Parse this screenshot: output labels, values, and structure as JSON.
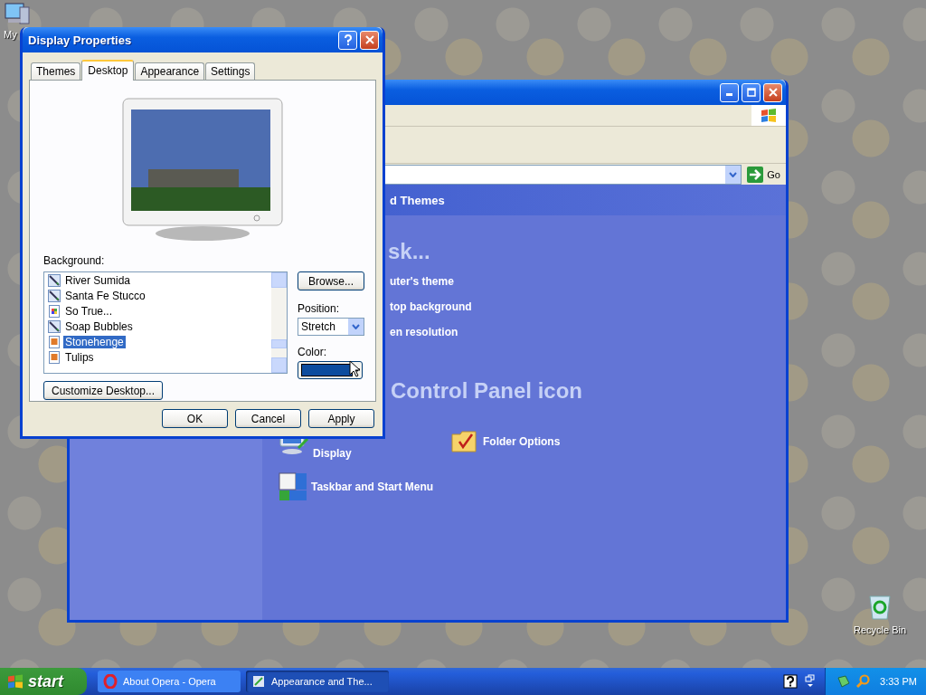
{
  "desktop_icons": [
    {
      "label": "My",
      "kind": "computer"
    },
    {
      "label": "Recycle Bin",
      "kind": "recycle"
    }
  ],
  "explorer_window": {
    "go_button": "Go",
    "header": "d Themes",
    "task_heading": "sk...",
    "tasks": [
      "uter's theme",
      "top background",
      "en resolution"
    ],
    "icon_heading": "Control Panel icon",
    "icons": [
      {
        "label": "Display",
        "kind": "display"
      },
      {
        "label": "Folder Options",
        "kind": "folder"
      },
      {
        "label": "Taskbar and Start Menu",
        "kind": "taskbar"
      }
    ]
  },
  "dialog": {
    "title": "Display Properties",
    "tabs": [
      {
        "label": "Themes",
        "selected": false
      },
      {
        "label": "Desktop",
        "selected": true
      },
      {
        "label": "Appearance",
        "selected": false
      },
      {
        "label": "Settings",
        "selected": false
      }
    ],
    "background_label": "Background:",
    "backgrounds": [
      {
        "label": "River Sumida",
        "kind": "brush",
        "selected": false
      },
      {
        "label": "Santa Fe Stucco",
        "kind": "brush",
        "selected": false
      },
      {
        "label": "So True...",
        "kind": "picture",
        "selected": false
      },
      {
        "label": "Soap Bubbles",
        "kind": "brush",
        "selected": false
      },
      {
        "label": "Stonehenge",
        "kind": "image",
        "selected": true
      },
      {
        "label": "Tulips",
        "kind": "image",
        "selected": false
      }
    ],
    "browse_button": "Browse...",
    "position_label": "Position:",
    "position": "Stretch",
    "color_label": "Color:",
    "color": "#0c4c9e",
    "customize_button": "Customize Desktop...",
    "buttons": [
      "OK",
      "Cancel",
      "Apply"
    ]
  },
  "taskbar": {
    "start": "start",
    "tasks": [
      {
        "label": "About Opera - Opera",
        "kind": "opera",
        "selected": false
      },
      {
        "label": "Appearance and The...",
        "kind": "folder",
        "selected": true
      }
    ],
    "clock": "3:33 PM"
  }
}
